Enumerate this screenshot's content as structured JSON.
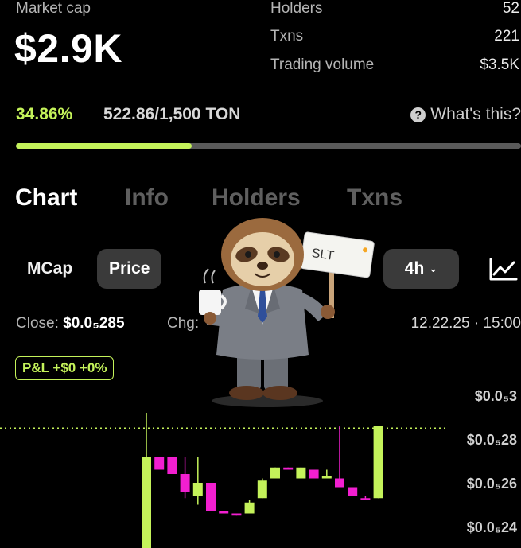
{
  "stats": {
    "market_cap_label": "Market cap",
    "market_cap_value": "$2.9K",
    "holders_label": "Holders",
    "holders_value": "52",
    "txns_label": "Txns",
    "txns_value": "221",
    "volume_label": "Trading volume",
    "volume_value": "$3.5K"
  },
  "progress": {
    "percent_text": "34.86%",
    "amount_text": "522.86/1,500 TON",
    "help_text": "What's this?",
    "fraction": 0.3486,
    "fill_color": "#c4f25a"
  },
  "tabs": [
    {
      "label": "Chart",
      "active": true
    },
    {
      "label": "Info",
      "active": false
    },
    {
      "label": "Holders",
      "active": false
    },
    {
      "label": "Txns",
      "active": false
    }
  ],
  "controls": {
    "mcap_label": "MCap",
    "price_label": "Price",
    "interval_label": "4h",
    "interval_icon": "chevron-down-icon",
    "chart_type_icon": "line-chart-icon"
  },
  "candle_info": {
    "close_label": "Close:",
    "close_value": "$0.0₅285",
    "chg_label": "Chg:",
    "datetime": "12.22.25 · 15:00"
  },
  "pnl_badge": "P&L +$0 +0%",
  "mascot": {
    "sign_text": "SLT"
  },
  "chart_data": {
    "type": "candlestick",
    "y_tick_labels": [
      "$0.0₅3",
      "$0.0₅28",
      "$0.0₅26",
      "$0.0₅24"
    ],
    "y_tick_values": [
      3.0,
      2.8,
      2.6,
      2.4
    ],
    "current_price_line": 2.85,
    "up_color": "#c4f25a",
    "down_color": "#f21fd0",
    "candles": [
      {
        "o": 2.2,
        "h": 2.92,
        "l": 2.2,
        "c": 2.72
      },
      {
        "o": 2.72,
        "h": 2.72,
        "l": 2.66,
        "c": 2.66
      },
      {
        "o": 2.72,
        "h": 2.72,
        "l": 2.64,
        "c": 2.64
      },
      {
        "o": 2.64,
        "h": 2.72,
        "l": 2.53,
        "c": 2.56
      },
      {
        "o": 2.54,
        "h": 2.72,
        "l": 2.5,
        "c": 2.6
      },
      {
        "o": 2.6,
        "h": 2.6,
        "l": 2.47,
        "c": 2.47
      },
      {
        "o": 2.47,
        "h": 2.47,
        "l": 2.46,
        "c": 2.46
      },
      {
        "o": 2.46,
        "h": 2.46,
        "l": 2.45,
        "c": 2.45
      },
      {
        "o": 2.46,
        "h": 2.52,
        "l": 2.46,
        "c": 2.51
      },
      {
        "o": 2.53,
        "h": 2.62,
        "l": 2.53,
        "c": 2.61
      },
      {
        "o": 2.62,
        "h": 2.67,
        "l": 2.62,
        "c": 2.67
      },
      {
        "o": 2.67,
        "h": 2.67,
        "l": 2.66,
        "c": 2.66
      },
      {
        "o": 2.62,
        "h": 2.67,
        "l": 2.62,
        "c": 2.67
      },
      {
        "o": 2.66,
        "h": 2.66,
        "l": 2.62,
        "c": 2.62
      },
      {
        "o": 2.62,
        "h": 2.66,
        "l": 2.62,
        "c": 2.63
      },
      {
        "o": 2.62,
        "h": 2.86,
        "l": 2.58,
        "c": 2.58
      },
      {
        "o": 2.58,
        "h": 2.58,
        "l": 2.54,
        "c": 2.54
      },
      {
        "o": 2.53,
        "h": 2.54,
        "l": 2.52,
        "c": 2.52
      },
      {
        "o": 2.53,
        "h": 2.86,
        "l": 2.53,
        "c": 2.86
      }
    ]
  }
}
